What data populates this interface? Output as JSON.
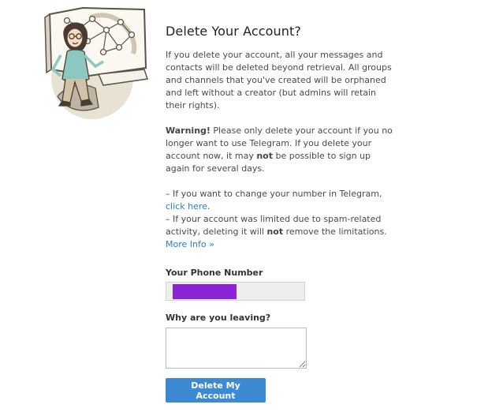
{
  "title": "Delete Your Account?",
  "intro": "If you delete your account, all your messages and contacts will be deleted beyond retrieval. All groups and channels that you've created will be orphaned and left without a creator (but admins will retain their rights).",
  "warning": {
    "label": "Warning!",
    "text_1": " Please only delete your account if you no longer want to use Telegram. If you delete your account now, it may ",
    "emphasis": "not",
    "text_2": " be possible to sign up again for several days."
  },
  "notes": {
    "change_number_text": "– If you want to change your number in Telegram, ",
    "change_number_link": "click here",
    "change_number_end": ".",
    "spam_text_1": "– If your account was limited due to spam-related activity, deleting it will ",
    "spam_emphasis": "not",
    "spam_text_2": " remove the limitations.",
    "more_info_link": "More Info »"
  },
  "form": {
    "phone_label": "Your Phone Number",
    "reason_label": "Why are you leaving?",
    "reason_value": "",
    "submit_label": "Delete My Account"
  },
  "colors": {
    "button": "#3c8ad2",
    "link": "#2481cc",
    "redaction": "#8a25d6"
  }
}
